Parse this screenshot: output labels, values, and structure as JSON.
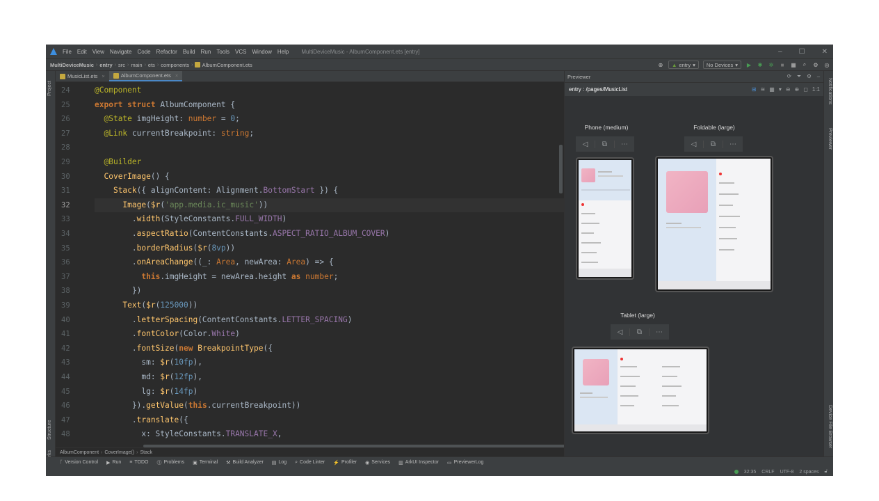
{
  "menu": {
    "items": [
      "File",
      "Edit",
      "View",
      "Navigate",
      "Code",
      "Refactor",
      "Build",
      "Run",
      "Tools",
      "VCS",
      "Window",
      "Help"
    ],
    "window_title": "MultiDeviceMusic - AlbumComponent.ets [entry]"
  },
  "navbar": {
    "crumbs": [
      "MultiDeviceMusic",
      "entry",
      "src",
      "main",
      "ets",
      "components",
      "AlbumComponent.ets"
    ],
    "module": "entry",
    "devices": "No Devices"
  },
  "left_strip": {
    "project": "Project",
    "structure": "Structure",
    "bookmarks": "Bookmarks"
  },
  "right_strip": {
    "notifications": "Notifications",
    "previewer": "Previewer",
    "device_file_browser": "Device File Browser"
  },
  "tabs": [
    {
      "label": "MusicList.ets"
    },
    {
      "label": "AlbumComponent.ets"
    }
  ],
  "editor": {
    "line_numbers": [
      "24",
      "25",
      "26",
      "27",
      "28",
      "29",
      "30",
      "31",
      "32",
      "33",
      "34",
      "35",
      "36",
      "37",
      "38",
      "39",
      "40",
      "41",
      "42",
      "43",
      "44",
      "45",
      "46",
      "47",
      "48"
    ],
    "current_line": "32"
  },
  "breadcrumb": [
    "AlbumComponent",
    "CoverImage()",
    "Stack"
  ],
  "toolwindows": [
    "Version Control",
    "Run",
    "TODO",
    "Problems",
    "Terminal",
    "Build Analyzer",
    "Log",
    "Code Linter",
    "Profiler",
    "Services",
    "ArkUI Inspector",
    "PreviewerLog"
  ],
  "status": {
    "position": "32:35",
    "line_sep": "CRLF",
    "encoding": "UTF-8",
    "indent": "2 spaces"
  },
  "previewer": {
    "title": "Previewer",
    "route": "entry : /pages/MusicList",
    "devices": [
      "Phone (medium)",
      "Foldable (large)",
      "Tablet (large)"
    ]
  },
  "colors": {
    "accent": "#4a88c7",
    "ide_bg": "#2b2b2b",
    "panel": "#3c3f41"
  }
}
